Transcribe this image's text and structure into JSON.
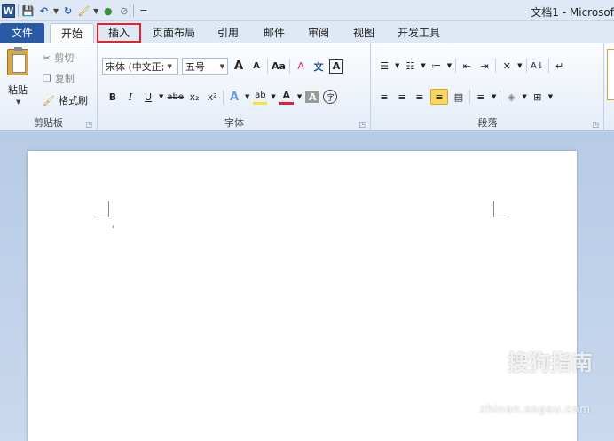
{
  "window": {
    "title": "文档1 - Microsof"
  },
  "qat": {
    "word_icon": "W",
    "save_icon": "save-icon",
    "undo_icon": "↶",
    "redo_icon": "↻",
    "brush_icon": "🖌",
    "palette_icon": "●",
    "erase_icon": "⊘",
    "more_icon": "="
  },
  "tabs": [
    {
      "label": "文件"
    },
    {
      "label": "开始"
    },
    {
      "label": "插入"
    },
    {
      "label": "页面布局"
    },
    {
      "label": "引用"
    },
    {
      "label": "邮件"
    },
    {
      "label": "审阅"
    },
    {
      "label": "视图"
    },
    {
      "label": "开发工具"
    }
  ],
  "clipboard": {
    "paste_label": "粘贴",
    "cut_label": "剪切",
    "copy_label": "复制",
    "format_painter_label": "格式刷",
    "group_label": "剪贴板"
  },
  "font": {
    "font_name": "宋体 (中文正;",
    "font_size": "五号",
    "grow": "A",
    "shrink": "A",
    "change_case": "Aa",
    "clear_format": "A",
    "phonetic": "文",
    "border_char": "A",
    "bold": "B",
    "italic": "I",
    "underline": "U",
    "strike": "abe",
    "subscript": "x₂",
    "superscript": "x²",
    "text_effect": "A",
    "highlight": "ab",
    "font_color": "A",
    "char_shade": "A",
    "enclose": "字",
    "group_label": "字体"
  },
  "paragraph": {
    "group_label": "段落",
    "sort": "A↓",
    "line_spacing": "≡"
  },
  "document": {
    "cursor": "'"
  },
  "watermark": {
    "text": "搜狗指南",
    "sub": "zhinan.sogou.com"
  },
  "colors": {
    "accent": "#2a5aa6",
    "highlight_red": "#e2232a",
    "font_red": "#e2232a",
    "highlight_yellow": "#f5e532"
  }
}
